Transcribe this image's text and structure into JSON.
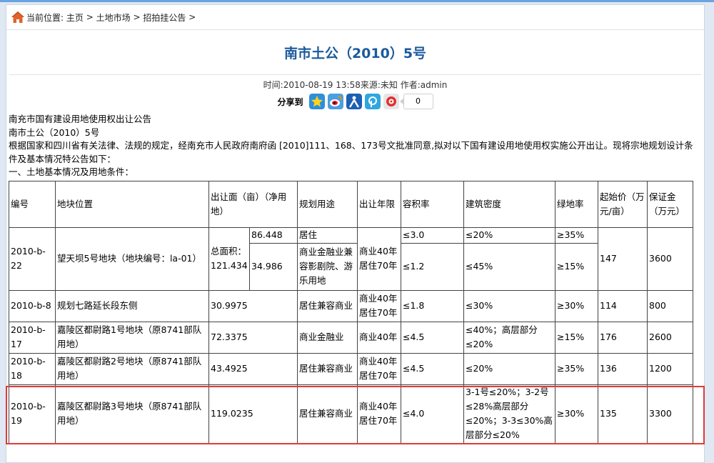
{
  "breadcrumb": {
    "prefix": "当前位置:",
    "items": [
      "主页",
      "土地市场",
      "招拍挂公告"
    ],
    "separator": ">"
  },
  "article": {
    "title": "南市土公（2010）5号",
    "meta": "时间:2010-08-19 13:58来源:未知 作者:admin",
    "share_label": "分享到",
    "share_icons": [
      "qzone-star-icon",
      "weibo-icon",
      "renren-icon",
      "pengyou-icon",
      "kaixin-icon"
    ],
    "share_count": "0",
    "paragraphs": [
      "南充市国有建设用地使用权出让公告",
      "南市土公（2010）5号",
      "根据国家和四川省有关法律、法规的规定，经南充市人民政府南府函 [2010]111、168、173号文批准同意,拟对以下国有建设用地使用权实施公开出让。现将宗地规划设计条件及基本情况特公告如下：",
      "一、土地基本情况及用地条件："
    ]
  },
  "table": {
    "headers": {
      "id": "编号",
      "location": "地块位置",
      "area": "出让面（亩）（净用地）",
      "use": "规划用途",
      "years": "出让年限",
      "far": "容积率",
      "density": "建筑密度",
      "green": "绿地率",
      "price": "起始价（万元/亩）",
      "deposit": "保证金（万元）"
    },
    "row1": {
      "id": "2010-b-22",
      "location": "望天坝5号地块（地块编号：la-01）",
      "area_total_label": "总面积：",
      "area_total": "121.434",
      "area_a": "86.448",
      "use_a": "居住",
      "area_b": "34.986",
      "use_b": "商业金融业兼容影剧院、游乐用地",
      "years": "商业40年居住70年",
      "far_a": "≤3.0",
      "density_a": "≤20%",
      "green_a": "≥35%",
      "far_b": "≤1.2",
      "density_b": "≤45%",
      "green_b": "≥15%",
      "price": "147",
      "deposit": "3600"
    },
    "rows": [
      {
        "id": "2010-b-8",
        "location": "规划七路延长段东侧",
        "area": "30.9975",
        "use": "居住兼容商业",
        "years": "商业40年居住70年",
        "far": "≤1.8",
        "density": "≤30%",
        "green": "≥30%",
        "price": "114",
        "deposit": "800"
      },
      {
        "id": "2010-b-17",
        "location": "嘉陵区都尉路1号地块（原8741部队用地）",
        "area": "72.3375",
        "use": "商业金融业",
        "years": "商业40年",
        "far": "≤4.5",
        "density": "≤40%；高层部分≤20%",
        "green": "≥15%",
        "price": "176",
        "deposit": "2600"
      },
      {
        "id": "2010-b-18",
        "location": "嘉陵区都尉路2号地块（原8741部队用地）",
        "area": "43.4925",
        "use": "居住兼容商业",
        "years": "商业40年居住70年",
        "far": "≤4.5",
        "density": "≤20%",
        "green": "≥35%",
        "price": "136",
        "deposit": "1200"
      },
      {
        "id": "2010-b-19",
        "location": "嘉陵区都尉路3号地块（原8741部队用地）",
        "area": "119.0235",
        "use": "居住兼容商业",
        "years": "商业40年居住70年",
        "far": "≤4.0",
        "density": "3-1号≤20%；3-2号≤28%高层部分≤20%；3-3≤30%高层部分≤20%",
        "green": "≥30%",
        "price": "135",
        "deposit": "3300"
      }
    ]
  },
  "colors": {
    "title": "#1a5a9c",
    "highlight": "#e03a3a",
    "background": "#dfe8f3"
  }
}
